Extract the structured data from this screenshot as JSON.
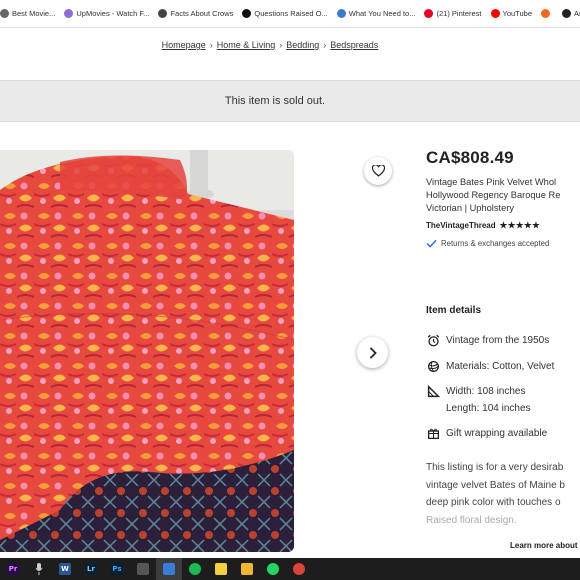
{
  "bookmarks": [
    {
      "label": "Best Movie...",
      "color": "#666666"
    },
    {
      "label": "UpMovies - Watch F...",
      "color": "#8e6bd6"
    },
    {
      "label": "Facts About Crows",
      "color": "#444444"
    },
    {
      "label": "Questions Raised O...",
      "color": "#111111"
    },
    {
      "label": "What You Need to...",
      "color": "#3b7bd4"
    },
    {
      "label": "(21) Pinterest",
      "color": "#e60023"
    },
    {
      "label": "YouTube",
      "color": "#ff0000"
    },
    {
      "label": "",
      "color": "#f26a21"
    },
    {
      "label": "Amazon.com: Rose...",
      "color": "#222222"
    }
  ],
  "breadcrumb": [
    "Homepage",
    "Home & Living",
    "Bedding",
    "Bedspreads"
  ],
  "sold_banner": "This item is sold out.",
  "listing": {
    "price": "CA$808.49",
    "title_lines": [
      "Vintage Bates Pink Velvet Whol",
      "Hollywood Regency Baroque Re",
      "Victorian | Upholstery"
    ],
    "shop_name": "TheVintageThread",
    "rating_stars": "★★★★★",
    "rating": 5,
    "returns_text": "Returns & exchanges accepted"
  },
  "item_details": {
    "heading": "Item details",
    "vintage": "Vintage from the 1950s",
    "materials": "Materials: Cotton, Velvet",
    "width": "Width: 108 inches",
    "length": "Length: 104 inches",
    "gift": "Gift wrapping available"
  },
  "description": {
    "lines": [
      "This listing is for a very desirab",
      "vintage velvet Bates of Maine b",
      "deep pink color with touches o"
    ],
    "faded_line": "Raised floral design."
  },
  "learn_more": "Learn more about",
  "taskbar": [
    {
      "name": "premiere-icon",
      "label": "Pr",
      "color": "#2a0a4a",
      "fg": "#e48cff"
    },
    {
      "name": "microphone-icon",
      "label": "",
      "color": "",
      "fg": ""
    },
    {
      "name": "word-icon",
      "label": "W",
      "color": "#2b5797",
      "fg": "#ffffff"
    },
    {
      "name": "lightroom-icon",
      "label": "Lr",
      "color": "#0a2033",
      "fg": "#7ec8f2"
    },
    {
      "name": "photoshop-icon",
      "label": "Ps",
      "color": "#0a1e33",
      "fg": "#31a8ff"
    },
    {
      "name": "calculator-icon",
      "label": "",
      "color": "#555555",
      "fg": "#ffffff"
    },
    {
      "name": "paint-icon",
      "label": "",
      "color": "#3d7bd9",
      "fg": "#ffffff"
    },
    {
      "name": "spotify-icon",
      "label": "",
      "color": "#1db954",
      "fg": "#000000"
    },
    {
      "name": "sticky-notes-icon",
      "label": "",
      "color": "#f4d03f",
      "fg": "#ffffff"
    },
    {
      "name": "file-explorer-icon",
      "label": "",
      "color": "#f2b632",
      "fg": "#ffffff"
    },
    {
      "name": "whatsapp-icon",
      "label": "",
      "color": "#25d366",
      "fg": "#ffffff"
    },
    {
      "name": "chrome-icon",
      "label": "",
      "color": "#db4437",
      "fg": "#ffffff"
    }
  ]
}
